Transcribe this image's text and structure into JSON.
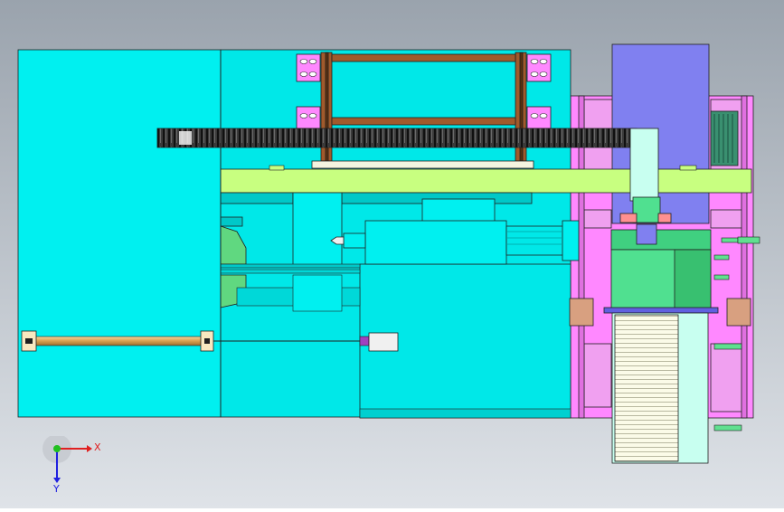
{
  "viewport": {
    "background_top": "#9aa3ad",
    "background_bottom": "#dfe3e8"
  },
  "colors": {
    "cyan_body": "#00f0f0",
    "lime_beam": "#c8ff80",
    "magenta_frame": "#ff88ff",
    "periwinkle": "#8080f0",
    "green_part": "#40d080",
    "brown_post": "#a05a2c",
    "rack_dark": "#2a2a2a",
    "rod_gold": "#e0b060",
    "tan_bearing": "#d8a080",
    "outline": "#202020"
  },
  "triad": {
    "x_label": "X",
    "y_label": "Y",
    "x_color": "#e02020",
    "y_color": "#2020e0",
    "origin_color": "#20c020"
  }
}
